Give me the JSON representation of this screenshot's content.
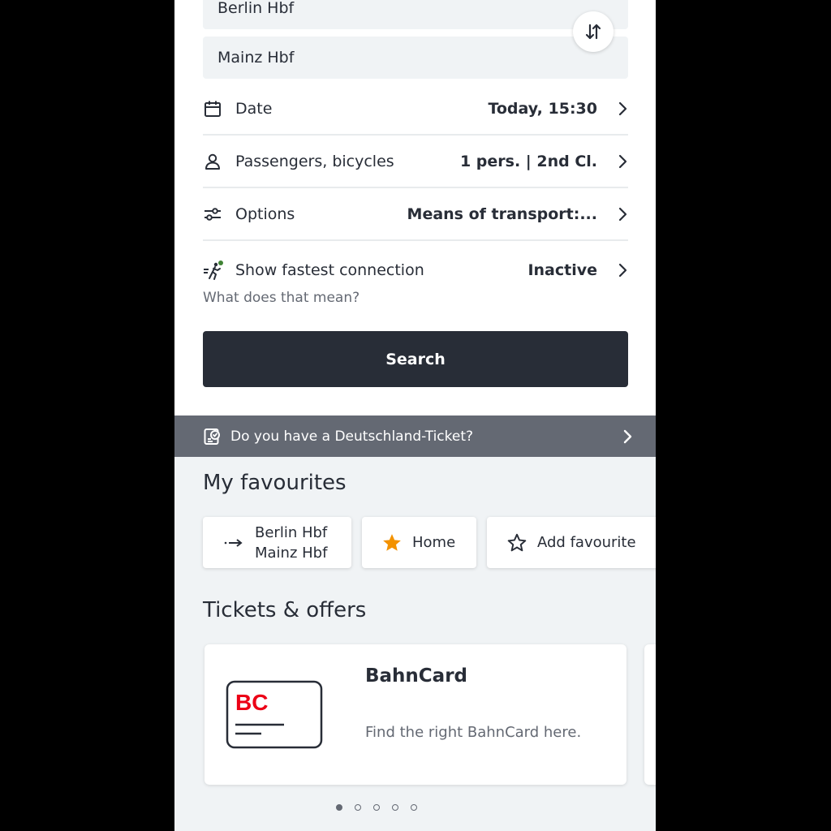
{
  "search_form": {
    "from_station": "Berlin Hbf",
    "to_station": "Mainz Hbf",
    "date": {
      "label": "Date",
      "value": "Today, 15:30"
    },
    "passengers": {
      "label": "Passengers, bicycles",
      "value": "1 pers. | 2nd Cl."
    },
    "options": {
      "label": "Options",
      "value": "Means of transport:..."
    },
    "fastest": {
      "label": "Show fastest connection",
      "value": "Inactive"
    },
    "info_link": "What does that mean?",
    "search_label": "Search"
  },
  "banner": {
    "label": "Do you have a Deutschland-Ticket?"
  },
  "favourites": {
    "title": "My favourites",
    "route": {
      "from": "Berlin Hbf",
      "to": "Mainz Hbf"
    },
    "home_label": "Home",
    "add_label": "Add favourite"
  },
  "offers": {
    "title": "Tickets & offers",
    "card": {
      "logo_text": "BC",
      "title": "BahnCard",
      "description": "Find the right BahnCard here."
    },
    "pager": {
      "count": 5,
      "active": 0
    }
  },
  "colors": {
    "accent_red": "#ec0016",
    "star_orange": "#f39200",
    "dark": "#282d37",
    "grey": "#646973",
    "green_dot": "#408335"
  }
}
